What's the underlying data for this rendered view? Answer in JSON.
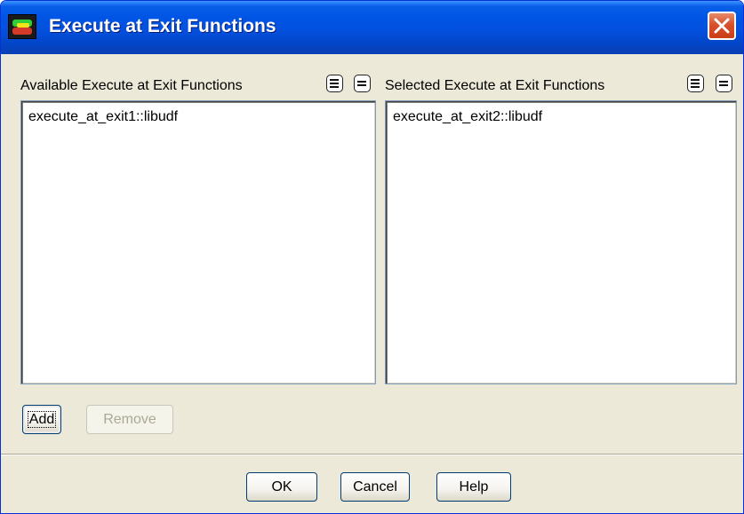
{
  "window": {
    "title": "Execute at Exit Functions"
  },
  "available": {
    "label": "Available Execute at Exit Functions",
    "items": [
      "execute_at_exit1::libudf"
    ]
  },
  "selected": {
    "label": "Selected Execute at Exit Functions",
    "items": [
      "execute_at_exit2::libudf"
    ]
  },
  "buttons": {
    "add": "Add",
    "remove": "Remove",
    "ok": "OK",
    "cancel": "Cancel",
    "help": "Help"
  },
  "colors": {
    "titlebar": "#0055e5",
    "dialog_bg": "#ece9d8",
    "close_button": "#d9512c"
  },
  "icons": {
    "app": "fluent-app-icon",
    "close": "close-icon",
    "select_all": "select-all-icon",
    "deselect_all": "deselect-all-icon"
  }
}
